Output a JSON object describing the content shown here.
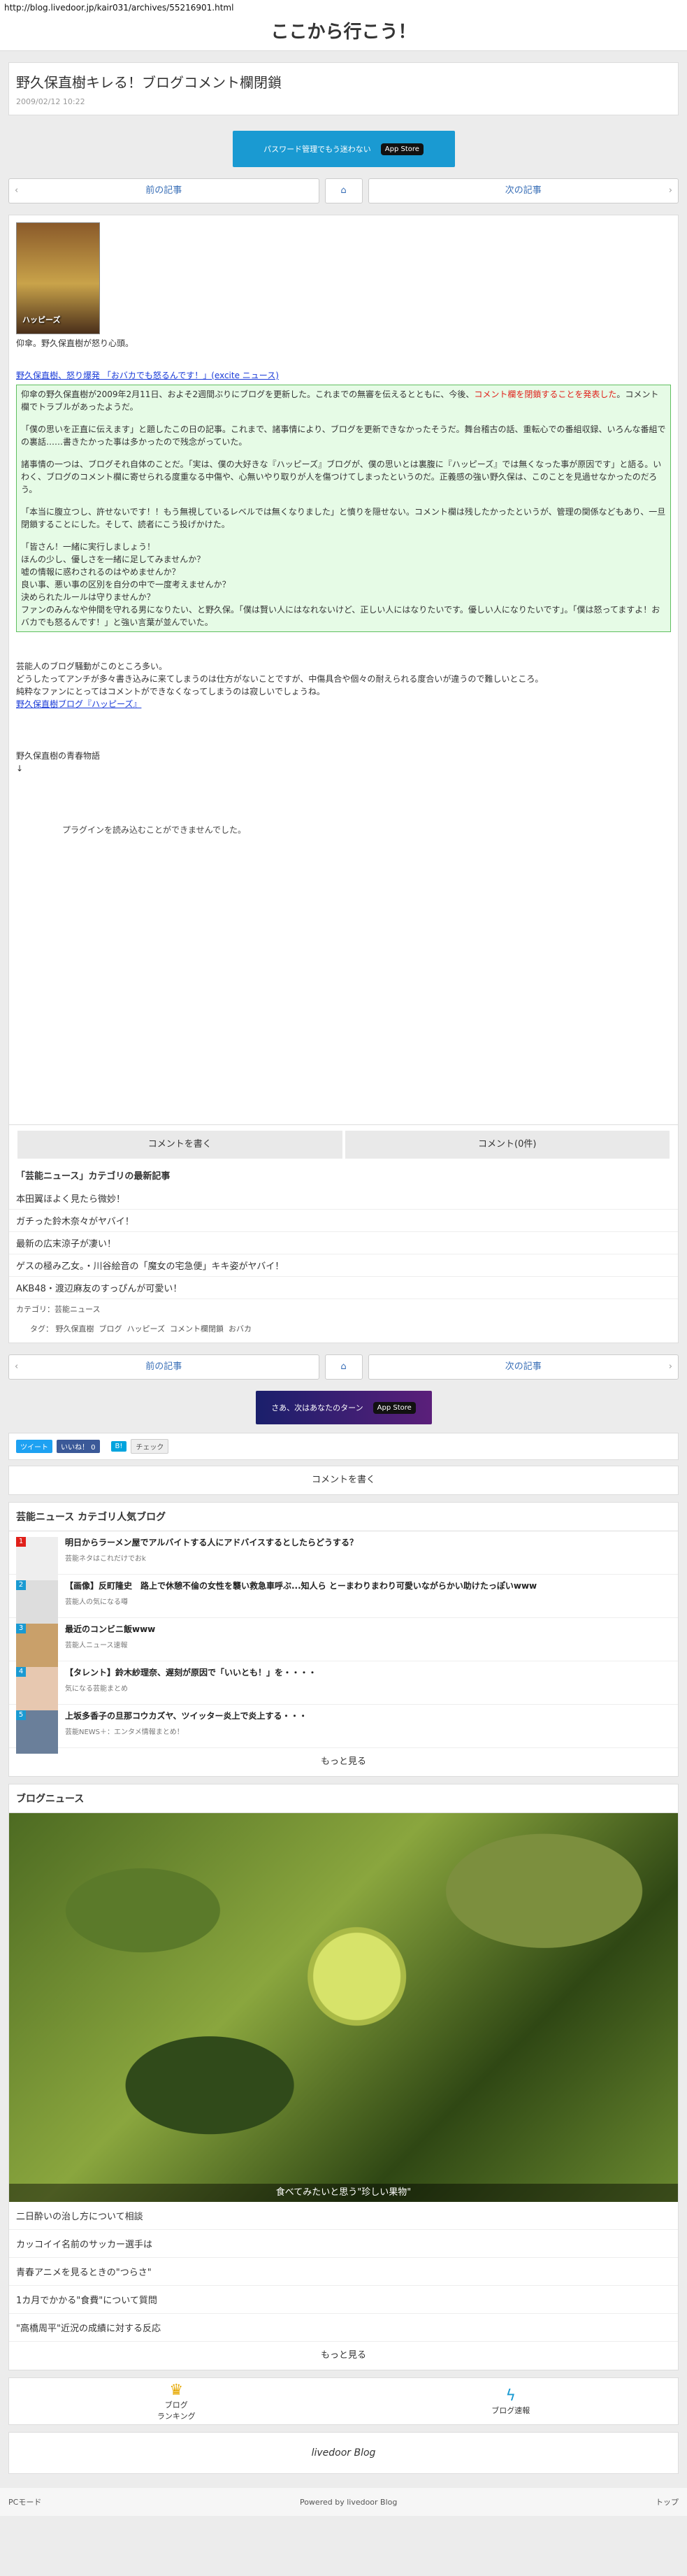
{
  "browser": {
    "url": "http://blog.livedoor.jp/kair031/archives/55216901.html"
  },
  "header": {
    "title": "ここから行こう！"
  },
  "article": {
    "title": "野久保直樹キレる！ブログコメント欄閉鎖",
    "date": "2009/02/12 10:22",
    "poster_text": "ハッピーズ",
    "intro": "仰傘。野久保直樹が怒り心頭。",
    "source_link": "野久保直樹、怒り爆発 「おバカでも怒るんです！」(excite ニュース)",
    "quote_p1_a": "仰傘の野久保直樹が2009年2月11日、およそ2週間ぶりにブログを更新した。これまでの無審を伝えるとともに、今後、",
    "quote_p1_red": "コメント欄を閉鎖することを発表した",
    "quote_p1_b": "。コメント欄でトラブルがあったようだ。",
    "quote_p2": "「僕の思いを正直に伝えます」と題したこの日の記事。これまで、諸事情により、ブログを更新できなかったそうだ。舞台稽古の話、重転心での番組収録、いろんな番組での裏話……書きたかった事は多かったので残念がっていた。",
    "quote_p3": "諸事情の一つは、ブログそれ自体のことだ。「実は、僕の大好きな『ハッピーズ』ブログが、僕の思いとは裏腹に『ハッピーズ』では無くなった事が原因です」と語る。いわく、ブログのコメント欄に寄せられる度重なる中傷や、心無いやり取りが人を傷つけてしまったというのだ。正義感の強い野久保は、このことを見過せなかったのだろう。",
    "quote_p4": "「本当に腹立つし、許せないです！！もう無視しているレベルでは無くなりました」と憤りを隠せない。コメント欄は残したかったというが、管理の関係などもあり、一旦閉鎖することにした。そして、読者にこう投げかけた。",
    "quote_p5a": "「皆さん！一緒に実行しましょう！",
    "quote_p5b": "ほんの少し、優しさを一緒に足してみませんか？",
    "quote_p5c": "嘘の情報に惑わされるのはやめませんか？",
    "quote_p5d": "良い事、悪い事の区別を自分の中で一度考えませんか？",
    "quote_p5e": "決められたルールは守りませんか？",
    "quote_p5f": "ファンのみんなや仲間を守れる男になりたい、と野久保。「僕は賢い人にはなれないけど、正しい人にはなりたいです。優しい人になりたいです」。「僕は怒ってますよ！おバカでも怒るんです！」と強い言葉が並んでいた。",
    "after1": "芸能人のブログ騒動がこのところ多い。",
    "after2": "どうしたってアンチが多々書き込みに来てしまうのは仕方がないことですが、中傷具合や個々の耐えられる度合いが違うので難しいところ。",
    "after3": "純粋なファンにとってはコメントができなくなってしまうのは寂しいでしょうね。",
    "blog_link": "野久保直樹ブログ『ハッピーズ』",
    "sub_title": "野久保直樹の青春物語",
    "arrow": "↓",
    "plugin_msg": "プラグインを読み込むことができませんでした。"
  },
  "banner1": {
    "text": "パスワード管理でもう迷わない",
    "store": "App Store"
  },
  "banner2": {
    "text": "さあ、次はあなたのターン",
    "store": "App Store"
  },
  "pager": {
    "prev": "前の記事",
    "next": "次の記事",
    "home_icon": "home-icon"
  },
  "comments": {
    "write": "コメントを書く",
    "count": "コメント(0件)"
  },
  "category": {
    "heading": "「芸能ニュース」カテゴリの最新記事",
    "items": [
      "本田翼ほよく見たら微妙！",
      "ガチった鈴木奈々がヤバイ！",
      "最新の広末涼子が凄い！",
      "ゲスの極み乙女。・川谷絵音の「魔女の宅急便」キキ姿がヤバイ！",
      "AKB48・渡辺麻友のすっぴんが可愛い！"
    ],
    "cat_label": "カテゴリ：",
    "cat_value": "芸能ニュース",
    "tag_label": "タグ：",
    "tags": [
      "野久保直樹",
      "ブログ",
      "ハッピーズ",
      "コメント欄閉鎖",
      "おバカ"
    ]
  },
  "share": {
    "tweet": "ツイート",
    "like": "いいね！ 0",
    "hatena": "B!",
    "check": "チェック"
  },
  "popular": {
    "heading": "芸能ニュース カテゴリ人気ブログ",
    "items": [
      {
        "rank": "1",
        "title": "明日からラーメン屋でアルバイトする人にアドバイスするとしたらどうする？",
        "source": "芸能ネタはこれだけでおk"
      },
      {
        "rank": "2",
        "title": "【画像】反町隆史　路上で休憩不倫の女性を襲い救急車呼ぶ...知人ら とーまわりまわり可愛いながらかい助けたっぽいwww",
        "source": "芸能人の気になる噂"
      },
      {
        "rank": "3",
        "title": "最近のコンビニ飯www",
        "source": "芸能人ニュース速報"
      },
      {
        "rank": "4",
        "title": "【タレント】鈴木紗理奈、遅刻が原因で「いいとも！」を・・・・",
        "source": "気になる芸能まとめ"
      },
      {
        "rank": "5",
        "title": "上坂多香子の旦那コウカズヤ、ツイッター炎上で炎上する・・・",
        "source": "芸能NEWS＋：エンタメ情報まとめ！"
      }
    ],
    "more": "もっと見る"
  },
  "blog_news": {
    "heading": "ブログニュース",
    "photo_caption": "食べてみたいと思う\"珍しい果物\"",
    "items": [
      "二日酔いの治し方について相談",
      "カッコイイ名前のサッカー選手は",
      "青春アニメを見るときの\"つらさ\"",
      "1カ月でかかる\"食費\"について質問",
      "\"高橋周平\"近況の成績に対する反応"
    ],
    "more": "もっと見る"
  },
  "bottom": {
    "ranking_line1": "ブログ",
    "ranking_line2": "ランキング",
    "speed": "ブログ速報"
  },
  "logo": {
    "text": "livedoor Blog"
  },
  "footer": {
    "pc_mode": "PCモード",
    "powered": "Powered by livedoor Blog",
    "top": "トップ"
  },
  "colors": {
    "accent": "#1a3bd8",
    "quote_bg": "#e6fbe6",
    "quote_border": "#5fbf5f",
    "red": "#e0201a"
  }
}
